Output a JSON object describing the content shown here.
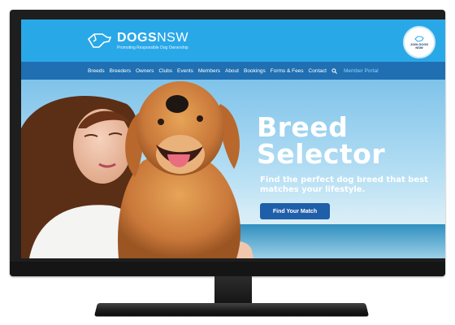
{
  "header": {
    "brand_bold": "DOGS",
    "brand_light": "NSW",
    "tagline": "Promoting Responsible Dog Ownership",
    "join_label": "JOIN DOGS NSW"
  },
  "nav": {
    "items": [
      "Breeds",
      "Breeders",
      "Owners",
      "Clubs",
      "Events",
      "Members",
      "About",
      "Bookings",
      "Forms & Fees",
      "Contact"
    ],
    "portal": "Member Portal"
  },
  "hero": {
    "title_line1": "Breed",
    "title_line2": "Selector",
    "subtitle": "Find the perfect dog breed that best matches your lifestyle.",
    "cta": "Find Your Match"
  },
  "colors": {
    "header_blue": "#29a8e8",
    "nav_blue": "#1f6fb2",
    "cta_blue": "#1f5ea8",
    "portal_text": "#8fd3ff"
  },
  "icons": [
    "dog-logo-icon",
    "search-icon",
    "join-badge-icon"
  ]
}
